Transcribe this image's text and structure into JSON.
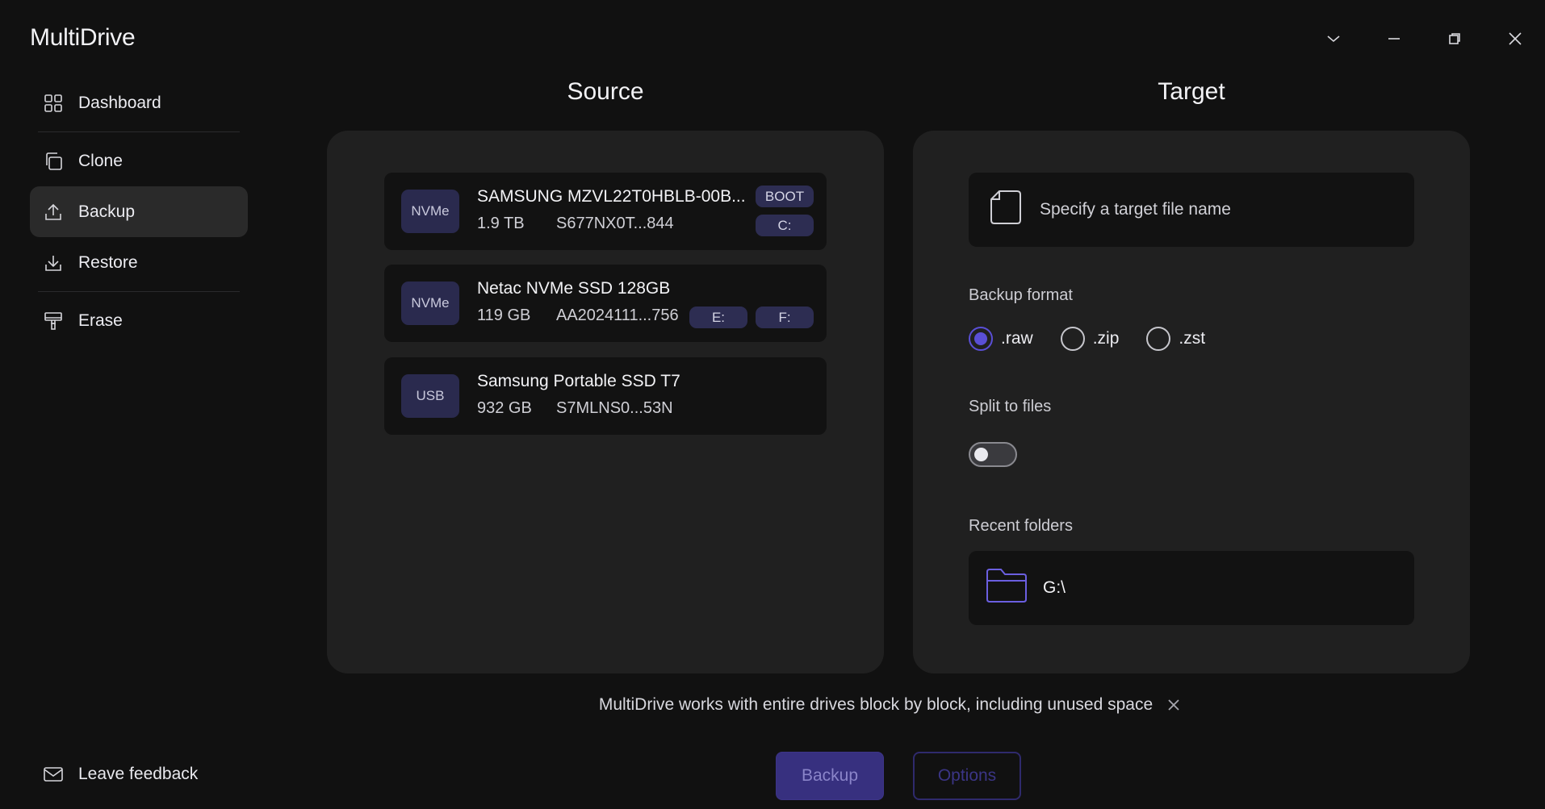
{
  "app": {
    "title": "MultiDrive"
  },
  "window_controls": [
    "chevron-down-icon",
    "minimize-icon",
    "restore-icon",
    "close-icon"
  ],
  "sidebar": {
    "items": [
      {
        "label": "Dashboard",
        "icon": "grid-icon",
        "active": false
      },
      {
        "label": "Clone",
        "icon": "copy-icon",
        "active": false
      },
      {
        "label": "Backup",
        "icon": "upload-icon",
        "active": true
      },
      {
        "label": "Restore",
        "icon": "download-icon",
        "active": false
      },
      {
        "label": "Erase",
        "icon": "paint-roller-icon",
        "active": false
      }
    ],
    "feedback": {
      "label": "Leave feedback",
      "icon": "mail-icon"
    }
  },
  "source": {
    "title": "Source",
    "drives": [
      {
        "type": "NVMe",
        "name": "SAMSUNG MZVL22T0HBLB-00B...",
        "size": "1.9 TB",
        "serial": "S677NX0T...844",
        "tags": [
          "BOOT",
          "C:"
        ]
      },
      {
        "type": "NVMe",
        "name": "Netac NVMe SSD 128GB",
        "size": "119 GB",
        "serial": "AA2024111...756",
        "tags": [
          "E:",
          "F:"
        ]
      },
      {
        "type": "USB",
        "name": "Samsung Portable SSD T7",
        "size": "932 GB",
        "serial": "S7MLNS0...53N",
        "tags": []
      }
    ]
  },
  "target": {
    "title": "Target",
    "file_placeholder": "Specify a target file name",
    "format_label": "Backup format",
    "formats": [
      {
        "label": ".raw",
        "selected": true
      },
      {
        "label": ".zip",
        "selected": false
      },
      {
        "label": ".zst",
        "selected": false
      }
    ],
    "split_label": "Split to files",
    "split_enabled": false,
    "recent_label": "Recent folders",
    "recent_folder": "G:\\"
  },
  "notice": {
    "text": "MultiDrive works with entire drives block by block, including unused space"
  },
  "actions": {
    "primary": "Backup",
    "secondary": "Options"
  },
  "colors": {
    "accent": "#5a4fd6",
    "badge_bg": "#2a2a4e",
    "panel_bg": "#202020",
    "app_bg": "#111111"
  }
}
